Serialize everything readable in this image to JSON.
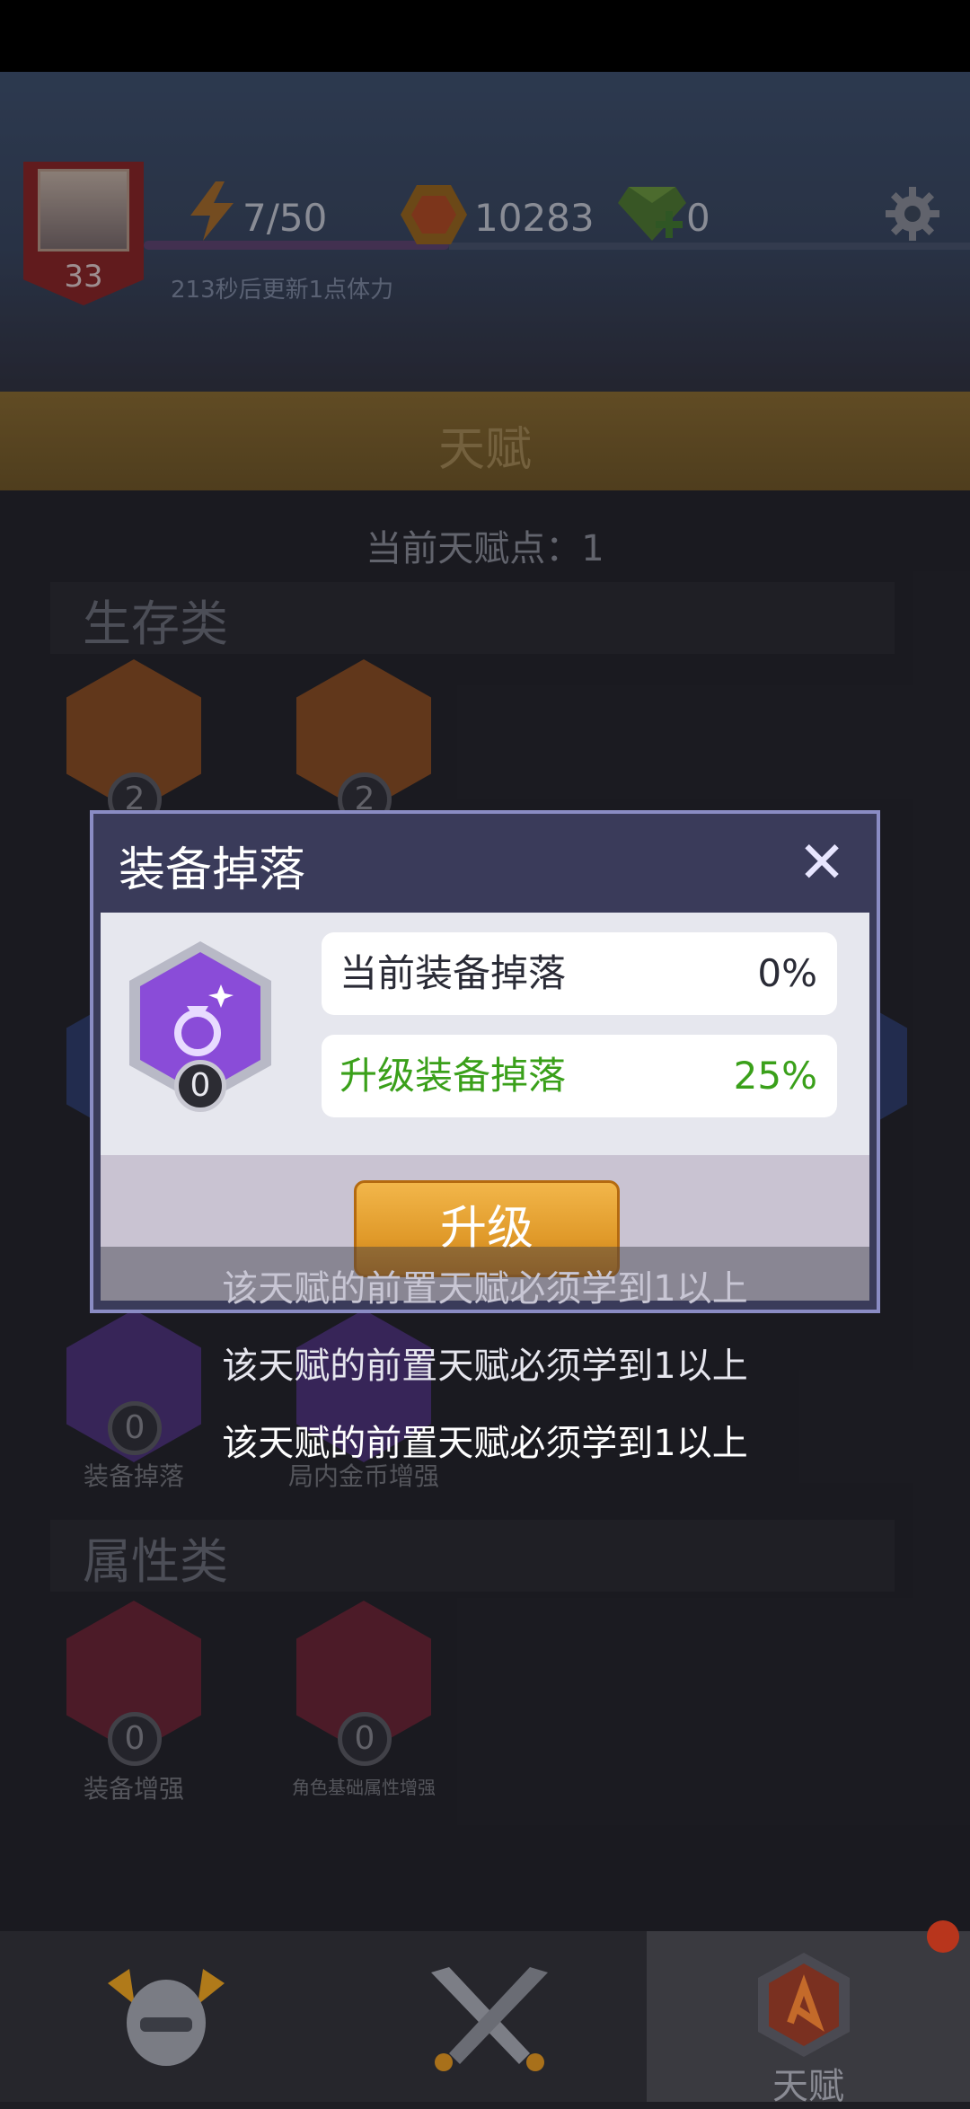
{
  "header": {
    "level": "33",
    "energy": "7/50",
    "coins": "10283",
    "gems": "0",
    "refresh_note": "213秒后更新1点体力"
  },
  "page": {
    "title": "天赋",
    "points_label": "当前天赋点：1"
  },
  "sections": {
    "survival": {
      "title": "生存类",
      "badges": [
        "2",
        "2"
      ]
    },
    "other": {
      "badges": [
        "0",
        ""
      ],
      "labels": [
        "装备掉落",
        "局内金币增强"
      ]
    },
    "attribute": {
      "title": "属性类",
      "badges": [
        "0",
        "0"
      ],
      "labels": [
        "装备增强",
        "角色基础属性增强"
      ]
    }
  },
  "dialog": {
    "title": "装备掉落",
    "close_glyph": "✕",
    "icon": "ring-gem-icon",
    "icon_level": "0",
    "current_label": "当前装备掉落",
    "current_value": "0%",
    "upgrade_label": "升级装备掉落",
    "upgrade_value": "25%",
    "button": "升级"
  },
  "toasts": [
    "该天赋的前置天赋必须学到1以上",
    "该天赋的前置天赋必须学到1以上",
    "该天赋的前置天赋必须学到1以上"
  ],
  "nav": {
    "active_label": "天赋"
  },
  "colors": {
    "accent_green": "#3aa01a",
    "button_orange": "#e09a2a",
    "dialog_purple": "#3a3b5a",
    "ring_purple": "#8a4cd8"
  }
}
